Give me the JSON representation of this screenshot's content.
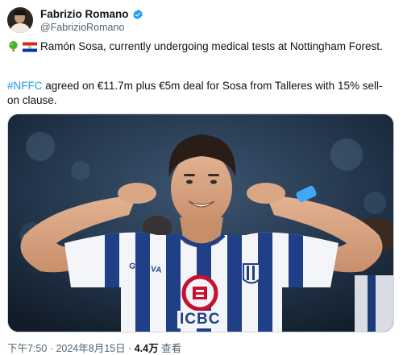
{
  "author": {
    "display_name": "Fabrizio Romano",
    "handle": "@FabrizioRomano",
    "verified_icon": "verified-badge-icon"
  },
  "post": {
    "line1_icons": [
      "tree-icon",
      "paraguay-flag-icon"
    ],
    "line1_text": "Ramón Sosa, currently undergoing medical tests at Nottingham Forest.",
    "line2_hashtag": "#NFFC",
    "line2_text": " agreed on €11.7m plus €5m deal for Sosa from Talleres with 15% sell-on clause."
  },
  "media": {
    "kit_text_left": "GIVOVA",
    "kit_text_sponsor": "ICBC"
  },
  "meta": {
    "time": "下午7:50",
    "separator1": " · ",
    "date": "2024年8月15日",
    "separator2": " · ",
    "views": "4.4万",
    "views_label": " 查看"
  },
  "colors": {
    "link": "#1d9bf0",
    "secondary_text": "#536471",
    "verified": "#1d9bf0"
  }
}
